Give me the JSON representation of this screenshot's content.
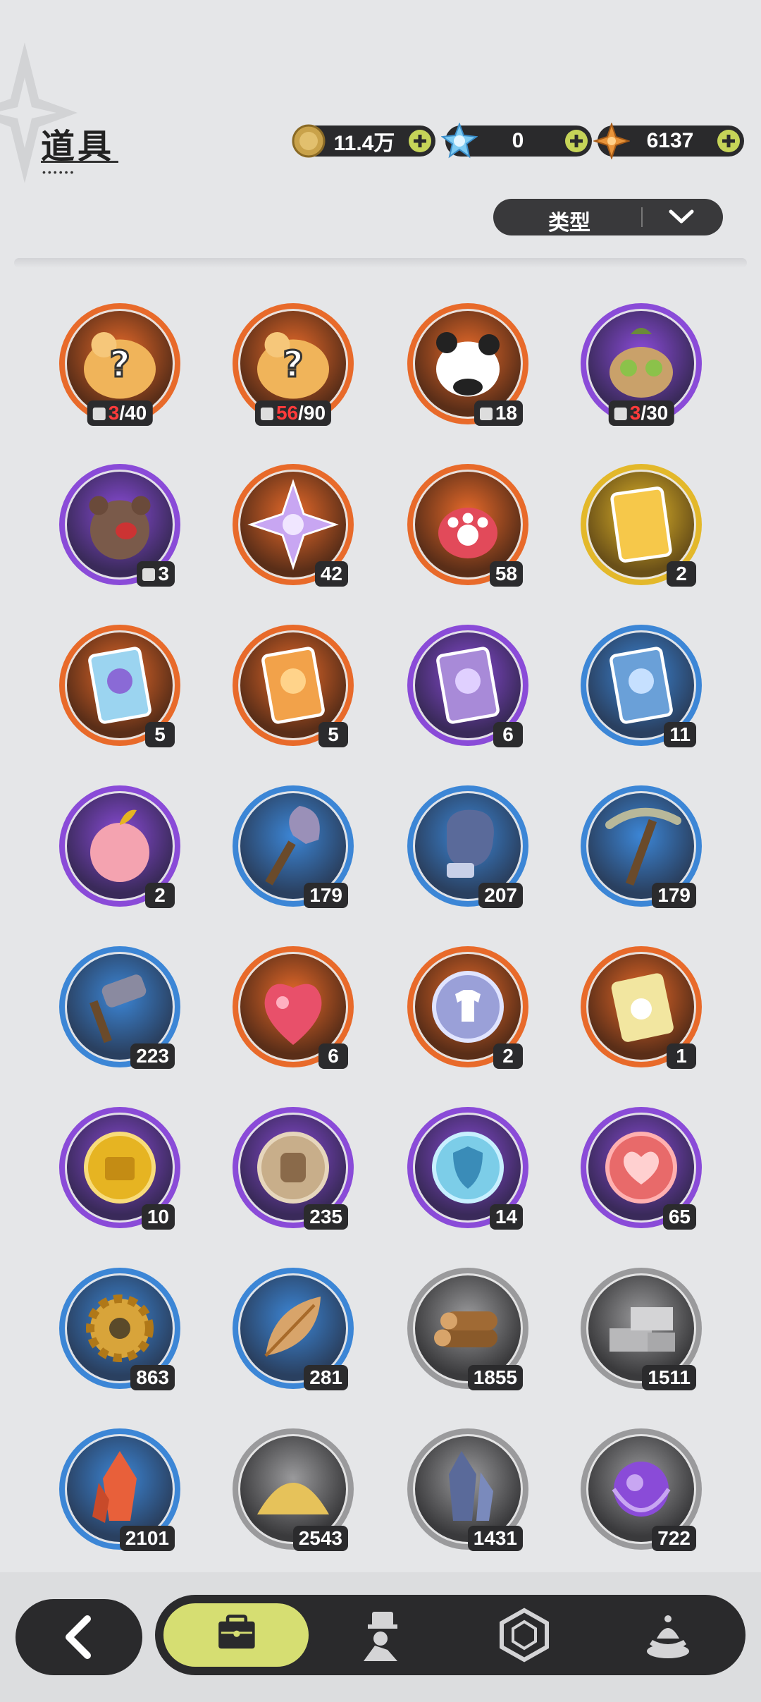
{
  "header": {
    "title": "道具"
  },
  "currencies": [
    {
      "name": "gold-coin",
      "value": "11.4万",
      "color": "#c9a24a"
    },
    {
      "name": "crystal",
      "value": "0",
      "color": "#7ecbf2"
    },
    {
      "name": "star-gem",
      "value": "6137",
      "color": "#e8943a"
    }
  ],
  "filter": {
    "label": "类型"
  },
  "items": [
    {
      "icon": "mystery-pieces-icon",
      "frame": "orange",
      "count": "3/40",
      "count_red": "3",
      "count_rest": "/40",
      "piece": true
    },
    {
      "icon": "mystery-pieces-icon",
      "frame": "orange",
      "count": "56/90",
      "count_red": "56",
      "count_rest": "/90",
      "piece": true
    },
    {
      "icon": "panda-piece-icon",
      "frame": "orange",
      "count": "18",
      "piece": true
    },
    {
      "icon": "creature-piece-icon",
      "frame": "purple",
      "count": "3/30",
      "count_red": "3",
      "count_rest": "/30",
      "piece": true
    },
    {
      "icon": "bear-piece-icon",
      "frame": "purple",
      "count": "3",
      "piece": true
    },
    {
      "icon": "crystal-star-icon",
      "frame": "orange",
      "count": "42"
    },
    {
      "icon": "paw-charm-icon",
      "frame": "orange",
      "count": "58"
    },
    {
      "icon": "gold-card-icon",
      "frame": "gold",
      "count": "2"
    },
    {
      "icon": "rainbow-card-icon",
      "frame": "orange",
      "count": "5"
    },
    {
      "icon": "orange-card-icon",
      "frame": "orange",
      "count": "5"
    },
    {
      "icon": "purple-card-icon",
      "frame": "purple",
      "count": "6"
    },
    {
      "icon": "blue-card-icon",
      "frame": "blue",
      "count": "11"
    },
    {
      "icon": "apple-icon",
      "frame": "purple",
      "count": "2"
    },
    {
      "icon": "shovel-icon",
      "frame": "blue",
      "count": "179"
    },
    {
      "icon": "glove-icon",
      "frame": "blue",
      "count": "207"
    },
    {
      "icon": "pickaxe-icon",
      "frame": "blue",
      "count": "179"
    },
    {
      "icon": "hammer-icon",
      "frame": "blue",
      "count": "223"
    },
    {
      "icon": "ruby-fruit-icon",
      "frame": "orange",
      "count": "6"
    },
    {
      "icon": "shirt-coin-icon",
      "frame": "orange",
      "count": "2"
    },
    {
      "icon": "puzzle-ticket-icon",
      "frame": "orange",
      "count": "1"
    },
    {
      "icon": "briefcase-coin-icon",
      "frame": "purple",
      "count": "10"
    },
    {
      "icon": "fist-coin-icon",
      "frame": "purple",
      "count": "235"
    },
    {
      "icon": "shield-coin-icon",
      "frame": "purple",
      "count": "14"
    },
    {
      "icon": "heart-coin-icon",
      "frame": "purple",
      "count": "65"
    },
    {
      "icon": "gear-icon",
      "frame": "blue",
      "count": "863"
    },
    {
      "icon": "leaf-icon",
      "frame": "blue",
      "count": "281"
    },
    {
      "icon": "logs-icon",
      "frame": "grey",
      "count": "1855"
    },
    {
      "icon": "stone-bricks-icon",
      "frame": "grey",
      "count": "1511"
    },
    {
      "icon": "red-crystal-icon",
      "frame": "blue",
      "count": "2101"
    },
    {
      "icon": "sand-pile-icon",
      "frame": "grey",
      "count": "2543"
    },
    {
      "icon": "blue-ore-icon",
      "frame": "grey",
      "count": "1431"
    },
    {
      "icon": "purple-orb-icon",
      "frame": "grey",
      "count": "722"
    }
  ],
  "frame_colors": {
    "orange": "#e86a2a",
    "purple": "#8a4bd8",
    "blue": "#3c86d6",
    "gold": "#e3b82a",
    "grey": "#9a9a9c"
  },
  "bottom_nav": [
    {
      "name": "back-icon"
    },
    {
      "name": "bag-icon",
      "active": true
    },
    {
      "name": "character-icon"
    },
    {
      "name": "gem-frame-icon"
    },
    {
      "name": "dessert-icon"
    }
  ]
}
